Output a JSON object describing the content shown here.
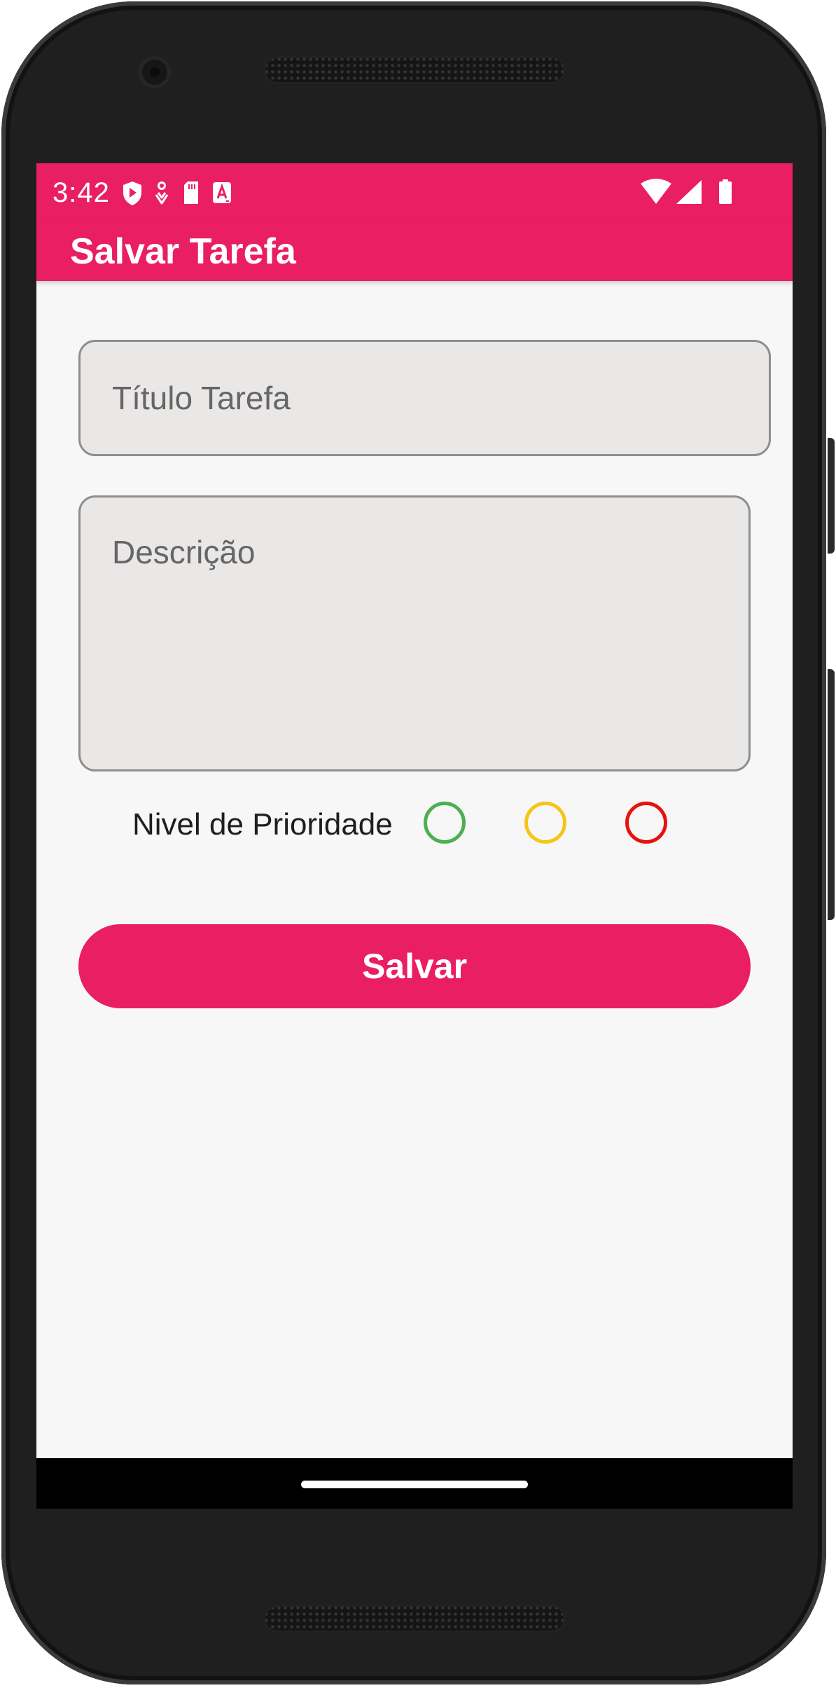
{
  "status_bar": {
    "time": "3:42",
    "color": "#e91e63",
    "left_icons": [
      "play-shield-icon",
      "gesture-icon",
      "sd-card-icon",
      "a-badge-icon"
    ],
    "right_icons": [
      "wifi-icon",
      "cellular-signal-icon",
      "battery-icon"
    ]
  },
  "app_bar": {
    "title": "Salvar Tarefa"
  },
  "form": {
    "title_field": {
      "placeholder": "Título Tarefa",
      "value": ""
    },
    "description_field": {
      "placeholder": "Descrição",
      "value": ""
    },
    "priority": {
      "label": "Nivel de Prioridade",
      "options": [
        {
          "name": "low",
          "color": "#4caf50",
          "selected": false
        },
        {
          "name": "medium",
          "color": "#f5c518",
          "selected": false
        },
        {
          "name": "high",
          "color": "#e8120c",
          "selected": false
        }
      ]
    },
    "save_label": "Salvar"
  },
  "theme": {
    "accent": "#e91e63",
    "background": "#f7f7f7",
    "field_background": "#eae7e7"
  }
}
